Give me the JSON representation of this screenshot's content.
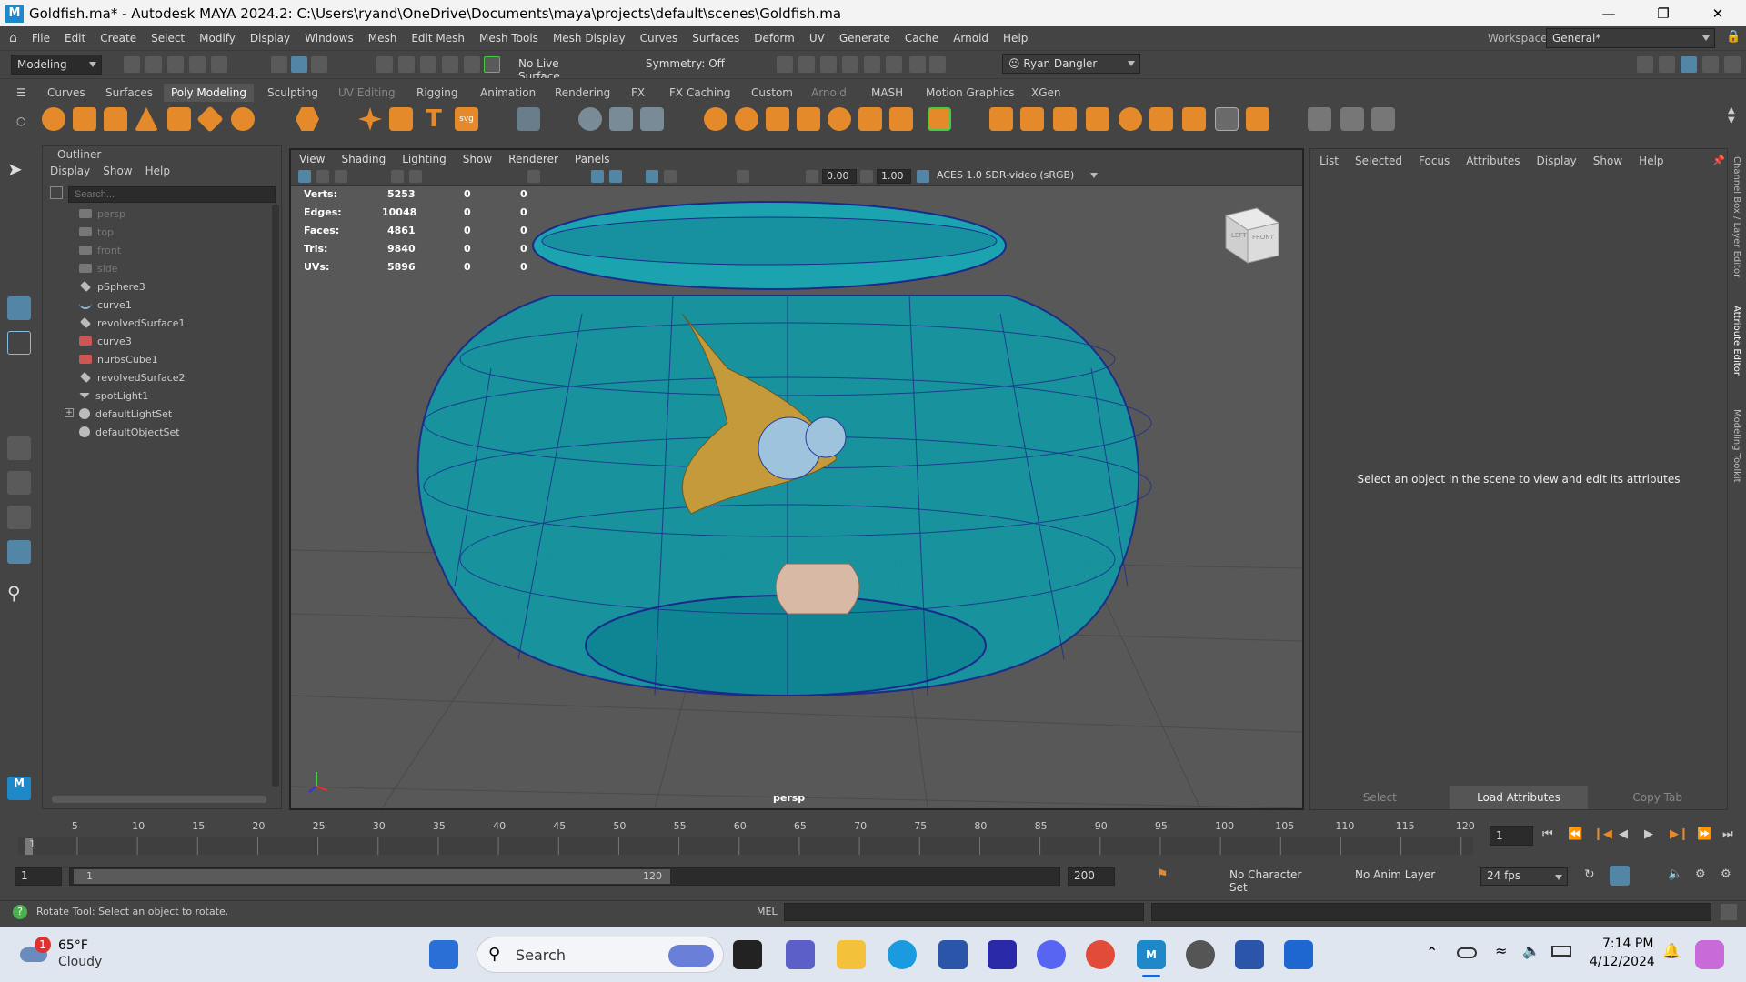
{
  "title_bar": {
    "app_letter": "M",
    "title": "Goldfish.ma* - Autodesk MAYA 2024.2: C:\\Users\\ryand\\OneDrive\\Documents\\maya\\projects\\default\\scenes\\Goldfish.ma"
  },
  "menu_bar": [
    "File",
    "Edit",
    "Create",
    "Select",
    "Modify",
    "Display",
    "Windows",
    "Mesh",
    "Edit Mesh",
    "Mesh Tools",
    "Mesh Display",
    "Curves",
    "Surfaces",
    "Deform",
    "UV",
    "Generate",
    "Cache",
    "Arnold",
    "Help"
  ],
  "workspace": {
    "label": "Workspace:",
    "value": "General*"
  },
  "status_line": {
    "mode": "Modeling",
    "live_surface": "No Live Surface",
    "symmetry": "Symmetry: Off",
    "user": "Ryan Dangler"
  },
  "shelf_tabs": [
    "Curves",
    "Surfaces",
    "Poly Modeling",
    "Sculpting",
    "UV Editing",
    "Rigging",
    "Animation",
    "Rendering",
    "FX",
    "FX Caching",
    "Custom",
    "Arnold",
    "MASH",
    "Motion Graphics",
    "XGen"
  ],
  "shelf_active": "Poly Modeling",
  "outliner": {
    "title": "Outliner",
    "menu": [
      "Display",
      "Show",
      "Help"
    ],
    "search_placeholder": "Search...",
    "items": [
      {
        "label": "persp",
        "dim": true
      },
      {
        "label": "top",
        "dim": true
      },
      {
        "label": "front",
        "dim": true
      },
      {
        "label": "side",
        "dim": true
      },
      {
        "label": "pSphere3",
        "dim": false
      },
      {
        "label": "curve1",
        "dim": false
      },
      {
        "label": "revolvedSurface1",
        "dim": false
      },
      {
        "label": "curve3",
        "dim": false
      },
      {
        "label": "nurbsCube1",
        "dim": false
      },
      {
        "label": "revolvedSurface2",
        "dim": false
      },
      {
        "label": "spotLight1",
        "dim": false
      },
      {
        "label": "defaultLightSet",
        "dim": false
      },
      {
        "label": "defaultObjectSet",
        "dim": false
      }
    ]
  },
  "viewport": {
    "menu": [
      "View",
      "Shading",
      "Lighting",
      "Show",
      "Renderer",
      "Panels"
    ],
    "exposure": "0.00",
    "gamma": "1.00",
    "color_space": "ACES 1.0 SDR-video (sRGB)",
    "camera_label": "persp",
    "cube_left": "LEFT",
    "cube_front": "FRONT",
    "hud": [
      {
        "label": "Verts:",
        "v1": "5253",
        "v2": "0",
        "v3": "0"
      },
      {
        "label": "Edges:",
        "v1": "10048",
        "v2": "0",
        "v3": "0"
      },
      {
        "label": "Faces:",
        "v1": "4861",
        "v2": "0",
        "v3": "0"
      },
      {
        "label": "Tris:",
        "v1": "9840",
        "v2": "0",
        "v3": "0"
      },
      {
        "label": "UVs:",
        "v1": "5896",
        "v2": "0",
        "v3": "0"
      }
    ]
  },
  "attribute_editor": {
    "menu": [
      "List",
      "Selected",
      "Focus",
      "Attributes",
      "Display",
      "Show",
      "Help"
    ],
    "message": "Select an object in the scene to view and edit its attributes",
    "footer": [
      "Select",
      "Load Attributes",
      "Copy Tab"
    ]
  },
  "side_tabs": [
    "Channel Box / Layer Editor",
    "Attribute Editor",
    "Modeling Toolkit"
  ],
  "time_slider": {
    "ticks": [
      "5",
      "10",
      "15",
      "20",
      "25",
      "30",
      "35",
      "40",
      "45",
      "50",
      "55",
      "60",
      "65",
      "70",
      "75",
      "80",
      "85",
      "90",
      "95",
      "100",
      "105",
      "110",
      "115",
      "120"
    ],
    "first": "1",
    "current_frame": "1"
  },
  "range_slider": {
    "start": "1",
    "range_start": "1",
    "range_end": "120",
    "end": "200",
    "character_set": "No Character Set",
    "anim_layer": "No Anim Layer",
    "fps": "24 fps"
  },
  "command_line": {
    "help": "Rotate Tool: Select an object to rotate.",
    "lang": "MEL"
  },
  "taskbar": {
    "weather_temp": "65°F",
    "weather_desc": "Cloudy",
    "weather_badge": "1",
    "search": "Search",
    "time": "7:14 PM",
    "date": "4/12/2024"
  }
}
